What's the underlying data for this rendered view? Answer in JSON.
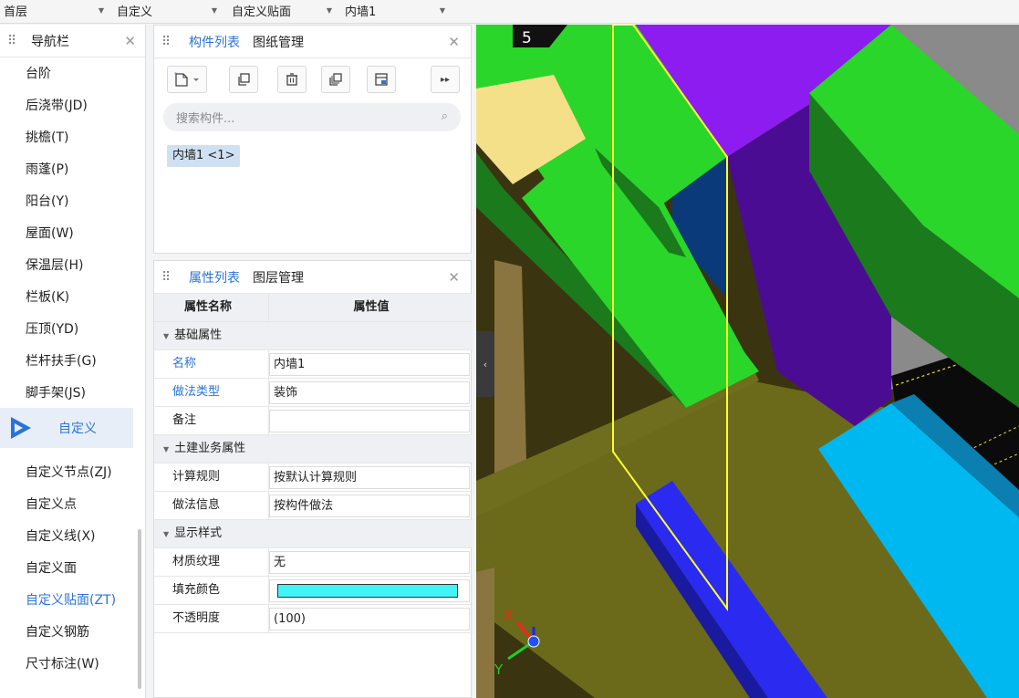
{
  "toolbar": {
    "floor": "首层",
    "type": "自定义",
    "subtype": "自定义贴面",
    "component": "内墙1"
  },
  "nav": {
    "title": "导航栏",
    "items": [
      "台阶",
      "后浇带(JD)",
      "挑檐(T)",
      "雨蓬(P)",
      "阳台(Y)",
      "屋面(W)",
      "保温层(H)",
      "栏板(K)",
      "压顶(YD)",
      "栏杆扶手(G)",
      "脚手架(JS)"
    ],
    "section": "自定义",
    "sub_items": [
      "自定义节点(ZJ)",
      "自定义点",
      "自定义线(X)",
      "自定义面",
      "自定义贴面(ZT)",
      "自定义钢筋",
      "尺寸标注(W)"
    ],
    "active_sub_item": "自定义贴面(ZT)"
  },
  "component_panel": {
    "tab_active": "构件列表",
    "tab_other": "图纸管理",
    "search_placeholder": "搜索构件...",
    "items": [
      "内墙1 <1>"
    ]
  },
  "property_panel": {
    "tab_active": "属性列表",
    "tab_other": "图层管理",
    "col_name": "属性名称",
    "col_value": "属性值",
    "group_basic": "基础属性",
    "group_civil": "土建业务属性",
    "group_display": "显示样式",
    "rows": {
      "name_label": "名称",
      "name_value": "内墙1",
      "method_label": "做法类型",
      "method_value": "装饰",
      "note_label": "备注",
      "note_value": "",
      "calc_label": "计算规则",
      "calc_value": "按默认计算规则",
      "info_label": "做法信息",
      "info_value": "按构件做法",
      "texture_label": "材质纹理",
      "texture_value": "无",
      "fill_label": "填充颜色",
      "fill_color": "#40f4f8",
      "opacity_label": "不透明度",
      "opacity_value": "(100)"
    }
  },
  "viewport": {
    "grid_label": "5",
    "axis_x": "X",
    "axis_y": "Y"
  }
}
